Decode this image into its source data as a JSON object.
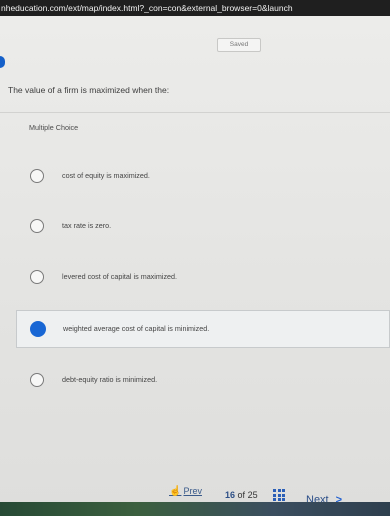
{
  "browser": {
    "url": "nheducation.com/ext/map/index.html?_con=con&external_browser=0&launch"
  },
  "status": {
    "saved_label": "Saved"
  },
  "question": {
    "text": "The value of a firm is maximized when the:",
    "type_label": "Multiple Choice",
    "options": [
      {
        "label": "cost of equity is maximized.",
        "selected": false
      },
      {
        "label": "tax rate is zero.",
        "selected": false
      },
      {
        "label": "levered cost of capital is maximized.",
        "selected": false
      },
      {
        "label": "weighted average cost of capital is minimized.",
        "selected": true
      },
      {
        "label": "debt-equity ratio is minimized.",
        "selected": false
      }
    ]
  },
  "footer": {
    "prev_label": "Prev",
    "current_page": "16",
    "of_label": "of",
    "total_pages": "25",
    "next_label": "Next",
    "next_icon": "chevron-right-icon",
    "prev_icon": "hand-pointer-icon",
    "grid_icon": "question-map-icon"
  },
  "colors": {
    "accent": "#1866d4",
    "link": "#2a4d87"
  }
}
